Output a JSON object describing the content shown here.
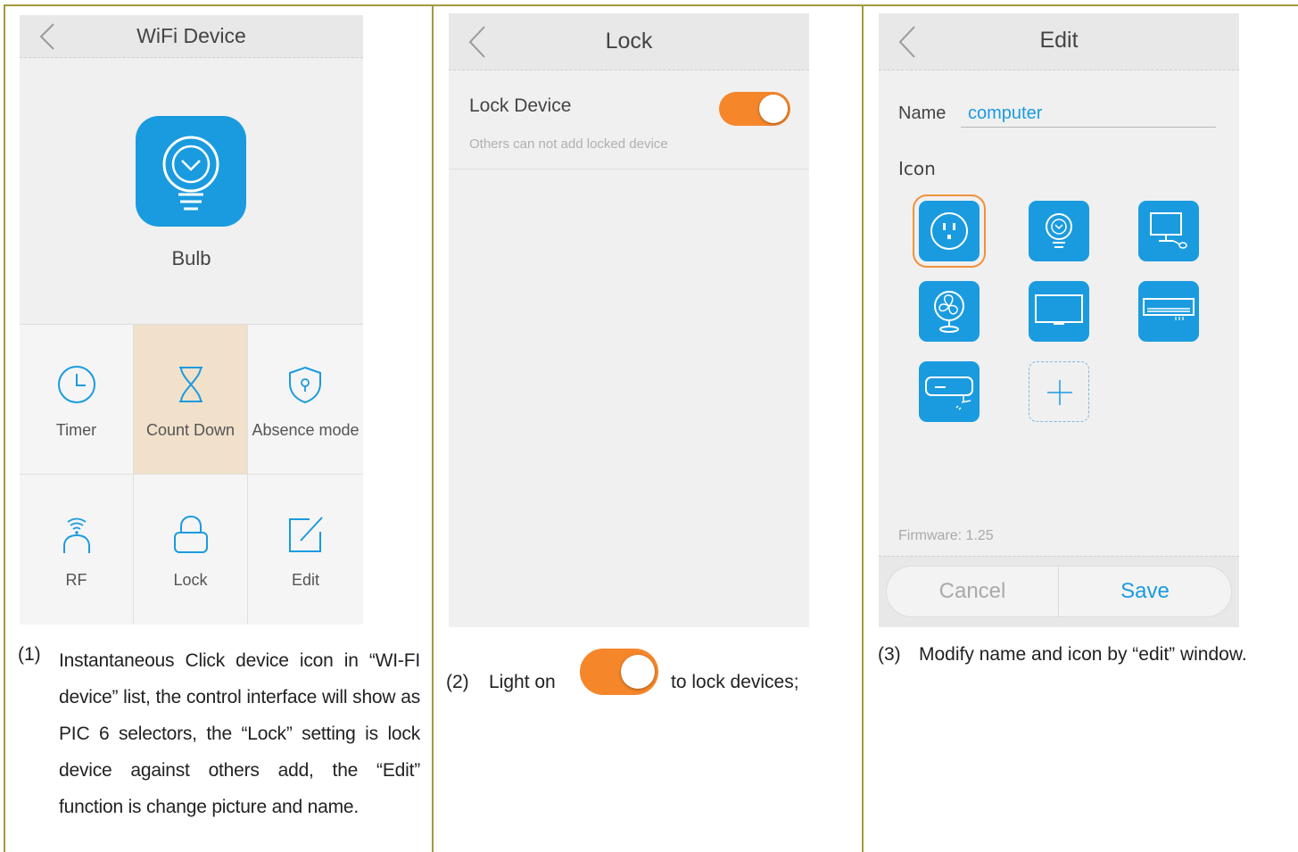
{
  "screen1": {
    "title": "WiFi Device",
    "device_name": "Bulb",
    "menu": [
      {
        "label": "Timer",
        "icon": "clock-icon"
      },
      {
        "label": "Count Down",
        "icon": "hourglass-icon",
        "active": true
      },
      {
        "label": "Absence mode",
        "icon": "shield-icon"
      },
      {
        "label": "RF",
        "icon": "rf-signal-icon"
      },
      {
        "label": "Lock",
        "icon": "lock-icon"
      },
      {
        "label": "Edit",
        "icon": "edit-icon"
      }
    ]
  },
  "screen2": {
    "title": "Lock",
    "lock_label": "Lock Device",
    "lock_hint": "Others can not add locked device",
    "lock_on": true
  },
  "screen3": {
    "title": "Edit",
    "name_label": "Name",
    "name_value": "computer",
    "icon_label": "Icon",
    "icons": [
      "socket-icon",
      "bulb-icon",
      "computer-icon",
      "fan-icon",
      "tv-icon",
      "air-conditioner-icon",
      "water-heater-icon",
      "add-icon"
    ],
    "firmware": "Firmware: 1.25",
    "cancel": "Cancel",
    "save": "Save"
  },
  "captions": {
    "c1_num": "(1)",
    "c1_text": "Instantaneous Click device icon in “WI-FI device” list, the control interface will show as PIC 6 selectors, the “Lock” setting is lock device against others add, the “Edit” function is change picture and name.",
    "c2_num": "(2)",
    "c2_a": "Light on",
    "c2_b": "to lock devices;",
    "c3_num": "(3)",
    "c3_text": "Modify name and icon by “edit” window."
  },
  "colors": {
    "accent_blue": "#1a9bdf",
    "toggle_orange": "#f5862a",
    "active_cell": "#f1e1cb",
    "table_border": "#a39a3c"
  }
}
